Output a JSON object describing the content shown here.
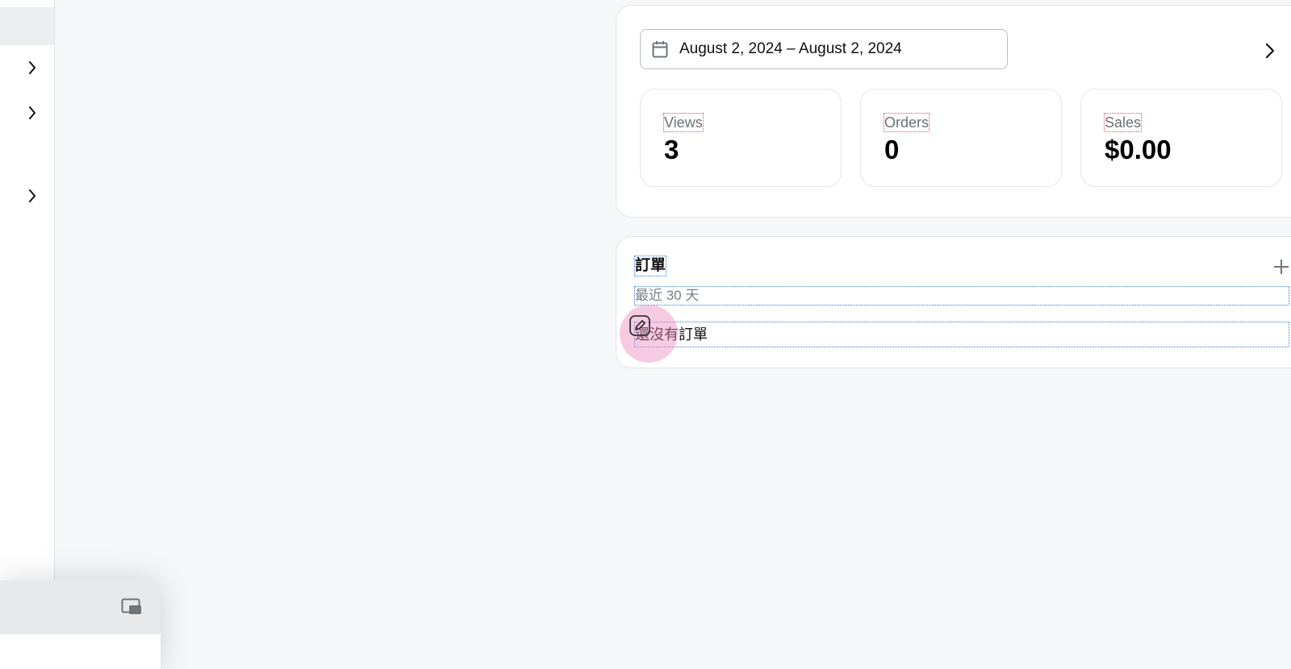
{
  "sidebar": {
    "chevrons": [
      "chevron-right-icon",
      "chevron-right-icon",
      "chevron-right-icon"
    ]
  },
  "float_panel": {
    "icon": "picture-in-picture-icon"
  },
  "stats": {
    "date_range": "August 2, 2024 – August 2, 2024",
    "calendar_icon": "calendar-icon",
    "next_icon": "chevron-right-icon",
    "metrics": [
      {
        "label": "Views",
        "value": "3"
      },
      {
        "label": "Orders",
        "value": "0"
      },
      {
        "label": "Sales",
        "value": "$0.00"
      }
    ]
  },
  "orders": {
    "title": "訂單",
    "subtitle": "最近 30 天",
    "empty_text": "還沒有訂單",
    "add_icon": "plus-icon",
    "edit_icon": "pencil-icon"
  },
  "colors": {
    "background": "#f6f7f8",
    "card": "#ffffff",
    "muted_text": "#6b7178",
    "touch_indicator": "#ec8cbe"
  }
}
